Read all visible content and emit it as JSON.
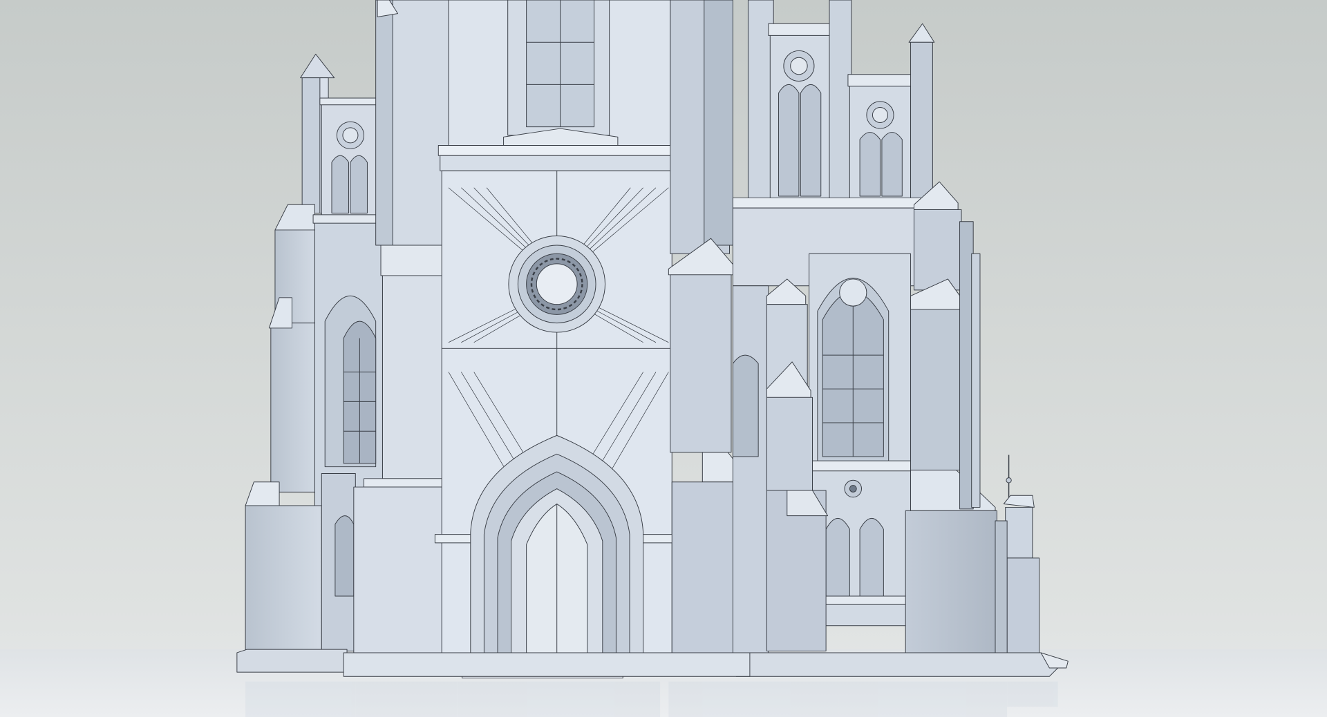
{
  "scene": {
    "subject": "cathedral-wireframe-render",
    "colors": {
      "background_top": "#c8cdcb",
      "background_bottom": "#dfe2e1",
      "floor": "#e4e7e8",
      "stone_light": "#dfe6ef",
      "stone_mid": "#c9d2de",
      "stone_dark": "#aab5c4",
      "edge": "#3a3f47"
    }
  }
}
